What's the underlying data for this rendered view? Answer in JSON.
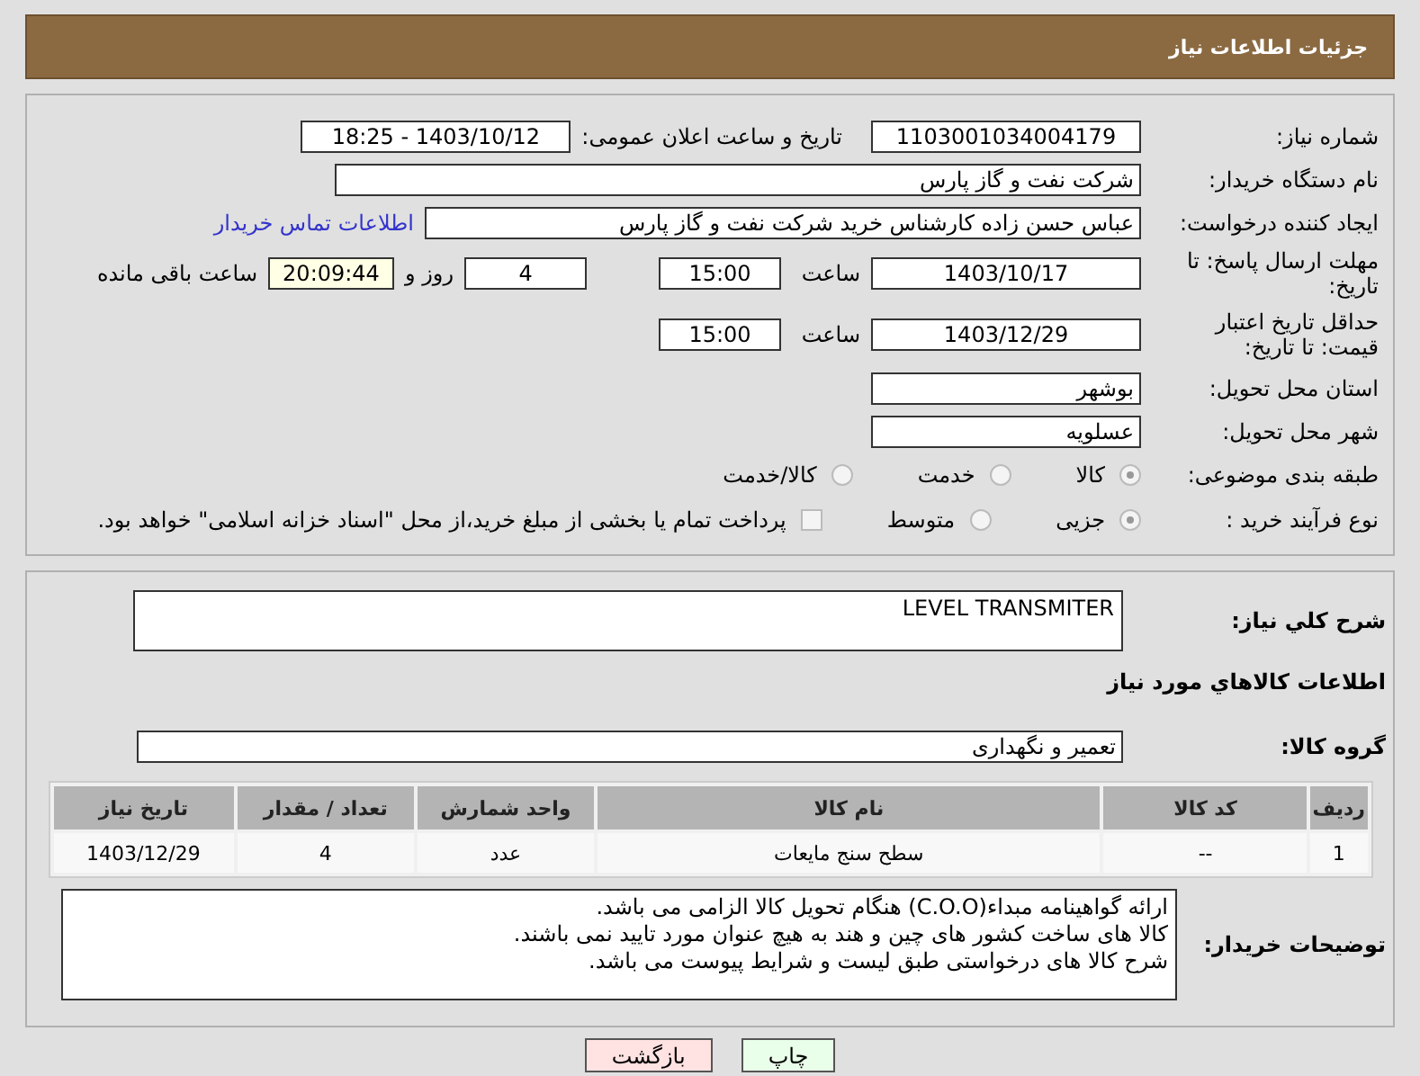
{
  "header": {
    "title": "جزئیات اطلاعات نیاز"
  },
  "need_number": {
    "label": "شماره نیاز:",
    "value": "1103001034004179"
  },
  "announce": {
    "label": "تاریخ و ساعت اعلان عمومی:",
    "value": "1403/10/12 - 18:25"
  },
  "buyer": {
    "label": "نام دستگاه خریدار:",
    "value": "شرکت نفت و گاز پارس"
  },
  "requester": {
    "label": "ایجاد کننده درخواست:",
    "value": "عباس حسن زاده کارشناس خرید شرکت نفت و گاز پارس",
    "link": "اطلاعات تماس خریدار"
  },
  "reply_deadline": {
    "label": "مهلت ارسال پاسخ: تا تاریخ:",
    "date": "1403/10/17",
    "time_label": "ساعت",
    "time": "15:00",
    "days": "4",
    "days_label": "روز و",
    "remaining": "20:09:44",
    "remaining_label": "ساعت باقی مانده"
  },
  "price_validity": {
    "label": "حداقل تاریخ اعتبار قیمت: تا تاریخ:",
    "date": "1403/12/29",
    "time_label": "ساعت",
    "time": "15:00"
  },
  "province": {
    "label": "استان محل تحویل:",
    "value": "بوشهر"
  },
  "city": {
    "label": "شهر محل تحویل:",
    "value": "عسلویه"
  },
  "category": {
    "label": "طبقه بندی موضوعی:",
    "options": [
      {
        "label": "کالا",
        "selected": true
      },
      {
        "label": "خدمت",
        "selected": false
      },
      {
        "label": "کالا/خدمت",
        "selected": false
      }
    ]
  },
  "purchase_type": {
    "label": "نوع فرآیند خرید :",
    "options": [
      {
        "label": "جزیی",
        "selected": true
      },
      {
        "label": "متوسط",
        "selected": false
      }
    ],
    "payment_note": {
      "label": "پرداخت تمام یا بخشی از مبلغ خرید،از محل \"اسناد خزانه اسلامی\" خواهد بود.",
      "checked": false
    }
  },
  "description": {
    "label": "شرح کلي نياز:",
    "value": "LEVEL TRANSMITER"
  },
  "items_heading": "اطلاعات کالاهاي مورد نياز",
  "goods_group": {
    "label": "گروه کالا:",
    "value": "تعمیر و نگهداری"
  },
  "table": {
    "columns": [
      "ردیف",
      "کد کالا",
      "نام کالا",
      "واحد شمارش",
      "تعداد / مقدار",
      "تاریخ نیاز"
    ],
    "rows": [
      [
        "1",
        "--",
        "سطح سنج مایعات",
        "عدد",
        "4",
        "1403/12/29"
      ]
    ]
  },
  "buyer_notes": {
    "label": "توضیحات خریدار:",
    "lines": [
      "ارائه گواهینامه مبداء(C.O.O) هنگام تحویل کالا الزامی می باشد.",
      "کالا های ساخت کشور های چین و هند به هیچ عنوان مورد تایید نمی باشند.",
      "شرح کالا های درخواستی طبق لیست و شرایط پیوست می باشد."
    ]
  },
  "buttons": [
    {
      "label": "چاپ",
      "kind": "print"
    },
    {
      "label": "بازگشت",
      "kind": "back"
    }
  ]
}
